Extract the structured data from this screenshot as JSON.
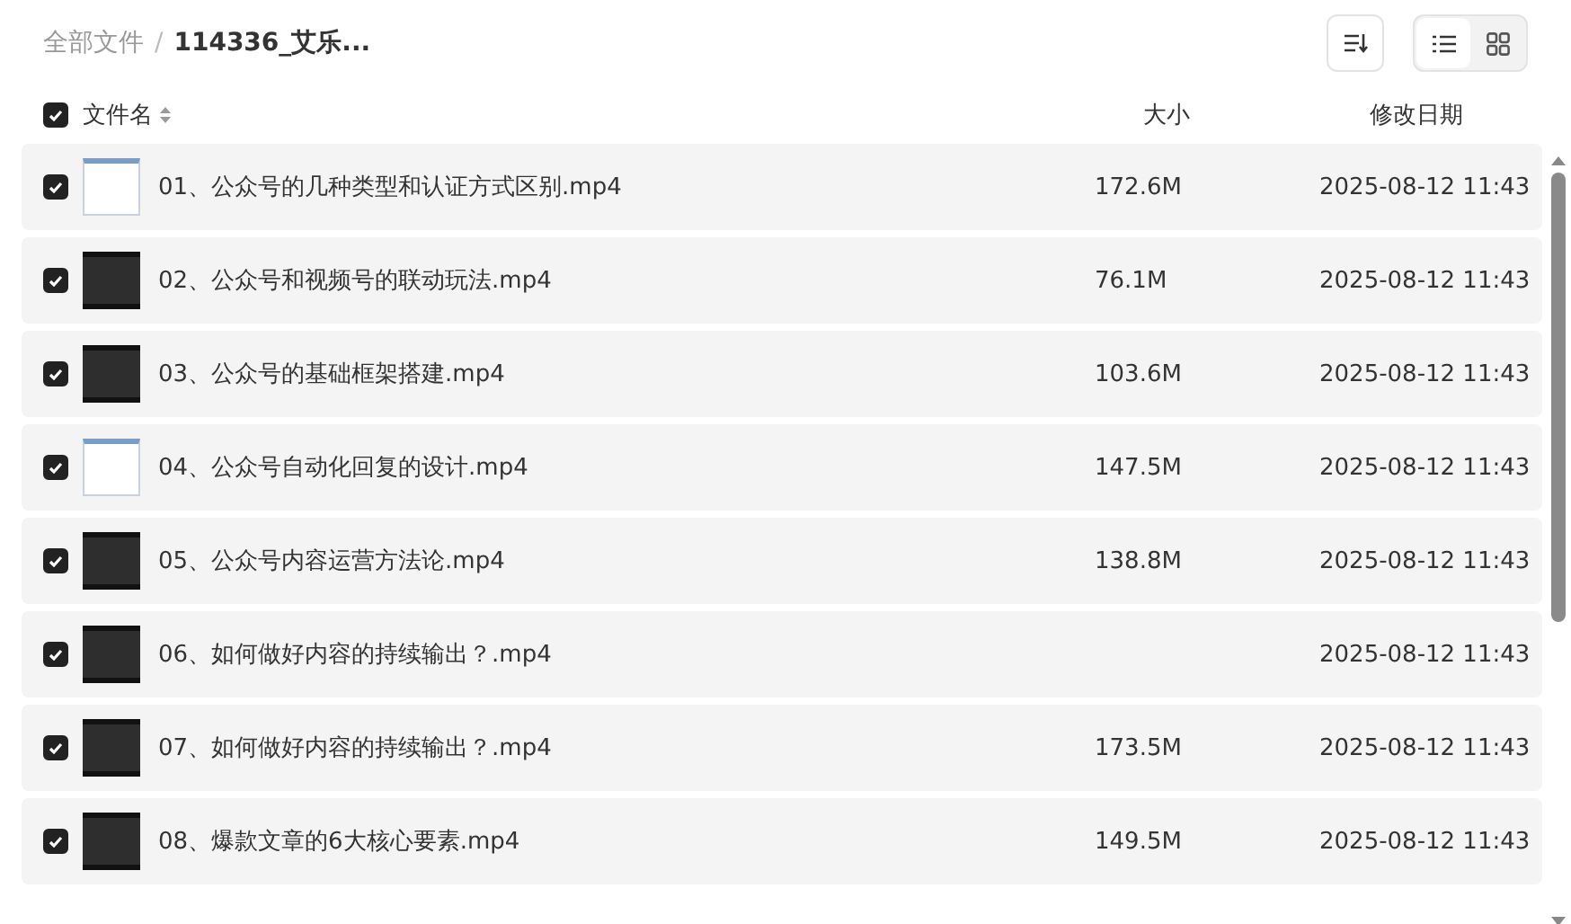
{
  "breadcrumb": {
    "root": "全部文件",
    "separator": "/",
    "current": "114336_艾乐..."
  },
  "toolbar": {
    "view_modes": [
      {
        "kind": "list",
        "selected": true
      },
      {
        "kind": "grid",
        "selected": false
      }
    ]
  },
  "table": {
    "header": {
      "checked": true,
      "columns": [
        "文件名",
        "大小",
        "修改日期"
      ]
    },
    "rows": [
      {
        "checked": true,
        "kind": "light",
        "name": "01、公众号的几种类型和认证方式区别.mp4",
        "size": "172.6M",
        "modified": "2025-08-12 11:43"
      },
      {
        "checked": true,
        "kind": "dark",
        "name": "02、公众号和视频号的联动玩法.mp4",
        "size": "76.1M",
        "modified": "2025-08-12 11:43"
      },
      {
        "checked": true,
        "kind": "dark",
        "name": "03、公众号的基础框架搭建.mp4",
        "size": "103.6M",
        "modified": "2025-08-12 11:43"
      },
      {
        "checked": true,
        "kind": "light",
        "name": "04、公众号自动化回复的设计.mp4",
        "size": "147.5M",
        "modified": "2025-08-12 11:43"
      },
      {
        "checked": true,
        "kind": "dark",
        "name": "05、公众号内容运营方法论.mp4",
        "size": "138.8M",
        "modified": "2025-08-12 11:43"
      },
      {
        "checked": true,
        "kind": "dark",
        "name": "06、如何做好内容的持续输出？.mp4",
        "modified": "2025-08-12 11:43"
      },
      {
        "checked": true,
        "kind": "dark",
        "name": "07、如何做好内容的持续输出？.mp4",
        "size": "173.5M",
        "modified": "2025-08-12 11:43"
      },
      {
        "checked": true,
        "kind": "dark",
        "name": "08、爆款文章的6大核心要素.mp4",
        "size": "149.5M",
        "modified": "2025-08-12 11:43"
      }
    ]
  }
}
